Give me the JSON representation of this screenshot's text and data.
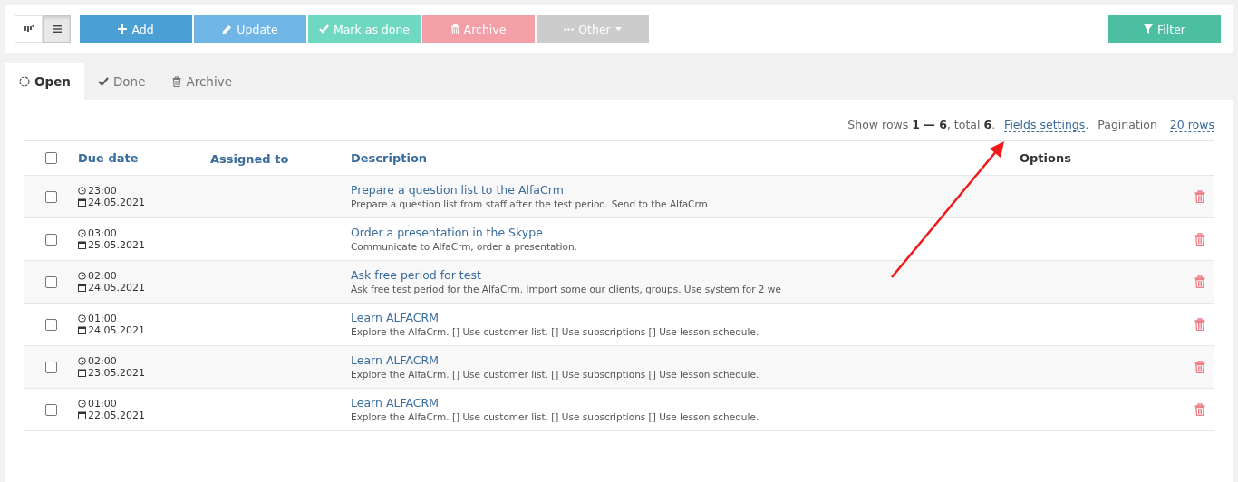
{
  "view_modes": [
    {
      "kind": "board",
      "selected": false
    },
    {
      "kind": "list",
      "selected": true
    }
  ],
  "actions": [
    {
      "kind": "add",
      "label": "Add",
      "color": "#4a9fd5"
    },
    {
      "kind": "update",
      "label": "Update",
      "color": "#6fb6e6"
    },
    {
      "kind": "done",
      "label": "Mark as done",
      "color": "#6ed8c0"
    },
    {
      "kind": "archive",
      "label": "Archive",
      "color": "#f49ea6"
    },
    {
      "kind": "other",
      "label": "Other",
      "color": "#cccccc"
    }
  ],
  "filter_button": {
    "label": "Filter"
  },
  "tabs": [
    {
      "kind": "open",
      "label": "Open",
      "selected": true
    },
    {
      "kind": "done",
      "label": "Done",
      "selected": false
    },
    {
      "kind": "archive",
      "label": "Archive",
      "selected": false
    }
  ],
  "info": {
    "text": "Show rows **1 — 6**, total **6**.",
    "fields_link": "Fields settings",
    "fields_dot": ".",
    "pagination_label": "Pagination",
    "pagination_link": "20 rows"
  },
  "table": {
    "select_all_checked": false,
    "columns": [
      "Due date",
      "Assigned to",
      "Description",
      "Options"
    ],
    "rows": [
      {
        "checked": false,
        "time": "23:00",
        "date": "24.05.2021",
        "title": "Prepare a question list to the AlfaCrm",
        "details": "Prepare a question list from staff after the test period. Send to the AlfaCrm"
      },
      {
        "checked": false,
        "time": "03:00",
        "date": "25.05.2021",
        "title": "Order a presentation in the Skype",
        "details": "Communicate to AlfaCrm, order a presentation."
      },
      {
        "checked": false,
        "time": "02:00",
        "date": "24.05.2021",
        "title": "Ask free period for test",
        "details": "Ask free test period for the AlfaCrm. Import some our clients, groups. Use system for 2 we"
      },
      {
        "checked": false,
        "time": "01:00",
        "date": "24.05.2021",
        "title": "Learn ALFACRM",
        "details": "Explore the AlfaCrm. [] Use customer list. [] Use subscriptions [] Use lesson schedule."
      },
      {
        "checked": false,
        "time": "02:00",
        "date": "23.05.2021",
        "title": "Learn ALFACRM",
        "details": "Explore the AlfaCrm. [] Use customer list. [] Use subscriptions [] Use lesson schedule."
      },
      {
        "checked": false,
        "time": "01:00",
        "date": "22.05.2021",
        "title": "Learn ALFACRM",
        "details": "Explore the AlfaCrm. [] Use customer list. [] Use subscriptions [] Use lesson schedule."
      }
    ]
  },
  "annotation": {
    "kind": "arrow"
  }
}
